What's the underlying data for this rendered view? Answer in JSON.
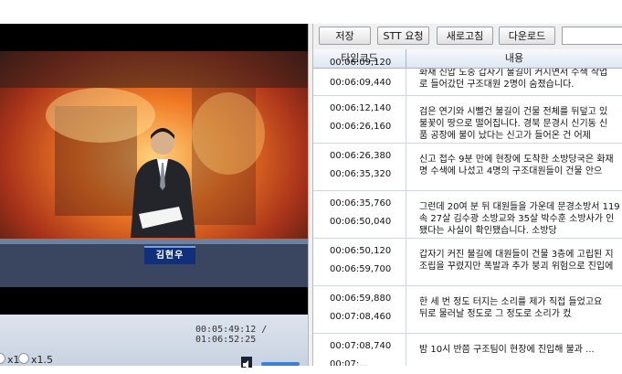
{
  "player": {
    "caption_name": "김현우",
    "time_display": "00:05:49:12 / 01:06:52:25",
    "speed_options": [
      "x1",
      "x1.5"
    ]
  },
  "toolbar": {
    "save_label": "저장",
    "stt_label": "STT 요청",
    "refresh_label": "새로고침",
    "download_label": "다운로드"
  },
  "grid": {
    "headers": [
      "타임코드",
      "내용"
    ],
    "rows": [
      {
        "start": "00:06:09,120",
        "end": "00:06:09,440",
        "lines": [
          "화재 진압 도중 갑자기 불길이 커지면서 수색 작업",
          "로 들어갔던 구조대원 2명이 숨졌습니다."
        ]
      },
      {
        "start": "00:06:12,140",
        "end": "00:06:26,160",
        "lines": [
          "검은 연기와 시뻘건 불길이 건물 전체를 뒤덮고 있",
          "불꽃이 땅으로 떨어집니다. 경북 문경시 신기동 신",
          "품 공장에 불이 났다는 신고가 들어온 건 어제"
        ]
      },
      {
        "start": "00:06:26,380",
        "end": "00:06:35,320",
        "lines": [
          "신고 접수 9분 만에 현장에 도착한 소방당국은 화재",
          "명 수색에 나섰고 4명의 구조대원들이 건물 안으"
        ]
      },
      {
        "start": "00:06:35,760",
        "end": "00:06:50,040",
        "lines": [
          "그런데 20여 분 뒤 대원들을 가운데 문경소방서 119",
          "속 27살 김수광 소방교와 35살 박수훈 소방사가 인",
          "됐다는 사실이 확인됐습니다. 소방당"
        ]
      },
      {
        "start": "00:06:50,120",
        "end": "00:06:59,700",
        "lines": [
          "갑자기 커진 불길에 대원들이 건물 3층에 고립된 지",
          "조립을 꾸렸지만 폭발과 추가 붕괴 위험으로 진입에"
        ]
      },
      {
        "start": "00:06:59,880",
        "end": "00:07:08,460",
        "lines": [
          "한 세 번 정도 터지는 소리를 제가 직접 들었고요",
          "뒤로 물러날 정도로 그 정도로 소리가 컸"
        ]
      },
      {
        "start": "00:07:08,740",
        "end": "00:07:...",
        "lines": [
          "밤 10시 반쯤 구조팀이 현장에 진입해 불과 ..."
        ]
      }
    ]
  }
}
